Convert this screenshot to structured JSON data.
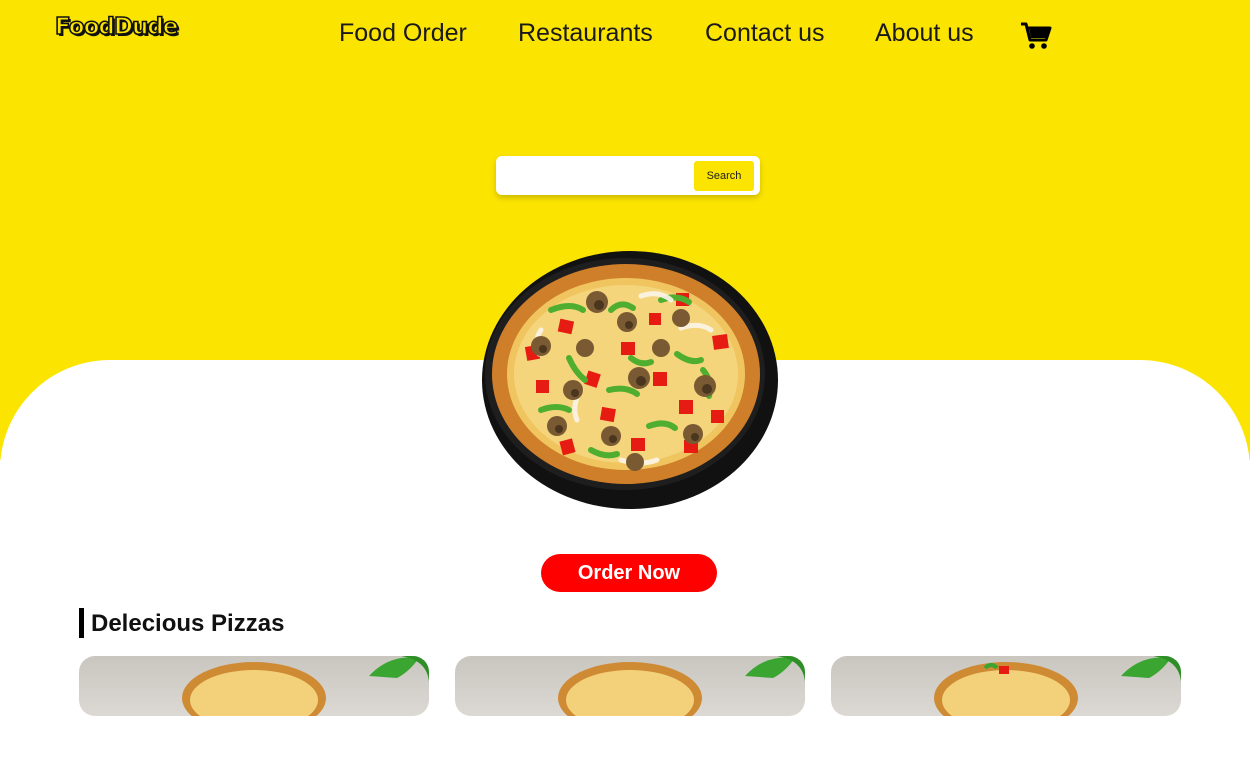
{
  "brand": {
    "logo_text": "FoodDude"
  },
  "nav": {
    "items": [
      {
        "label": "Food Order"
      },
      {
        "label": "Restaurants"
      },
      {
        "label": "Contact us"
      },
      {
        "label": "About us"
      }
    ],
    "cart_icon": "cart-icon"
  },
  "search": {
    "value": "",
    "placeholder": "",
    "button_label": "Search"
  },
  "hero": {
    "image": "pizza-image",
    "cta_label": "Order Now"
  },
  "section": {
    "title": "Delecious Pizzas",
    "cards": [
      {
        "image": "pizza-card-image"
      },
      {
        "image": "pizza-card-image"
      },
      {
        "image": "pizza-card-image"
      }
    ]
  },
  "colors": {
    "accent": "#fbe400",
    "cta": "#ff0000",
    "text": "#1a1a1a",
    "background": "#ffffff"
  }
}
